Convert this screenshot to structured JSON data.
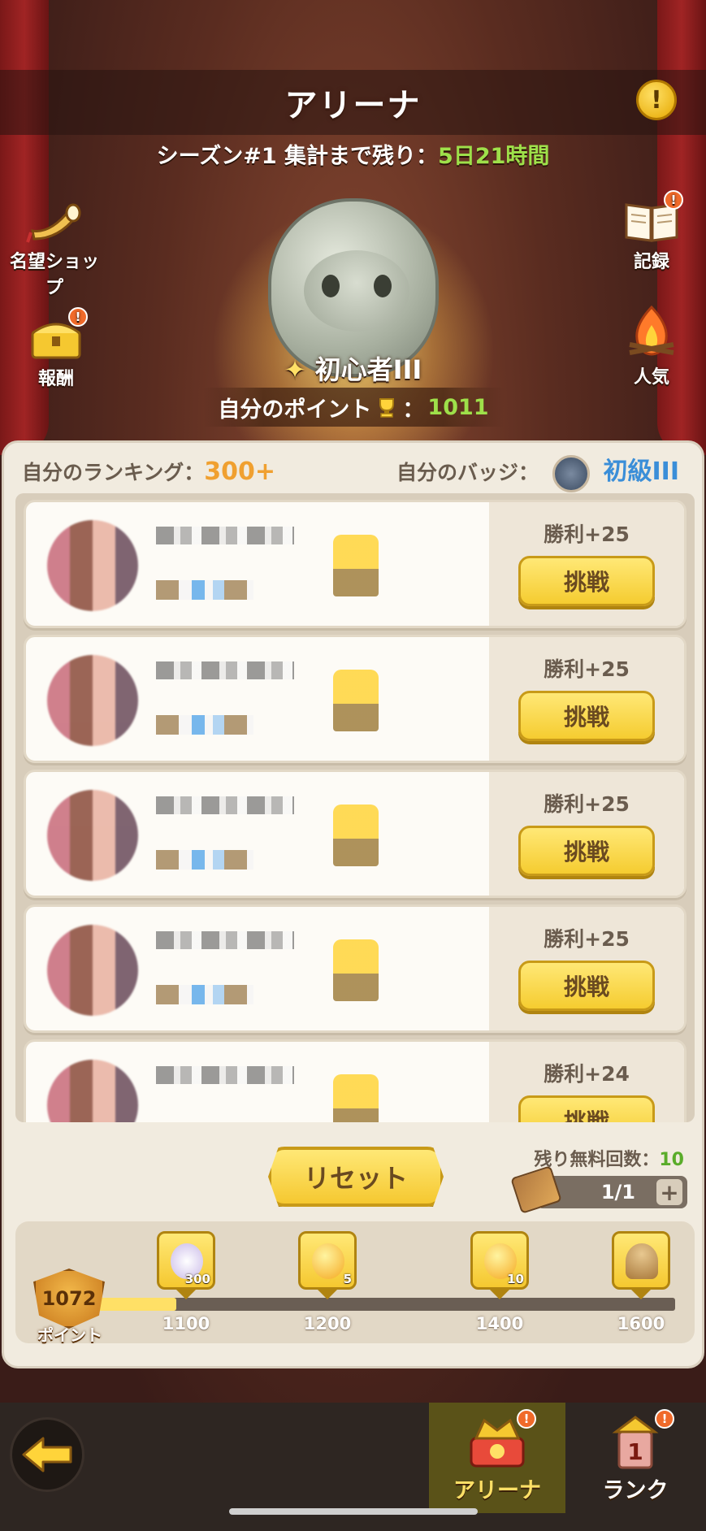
{
  "header": {
    "title": "アリーナ",
    "info_icon": "exclamation-icon",
    "season_text": "シーズン#1 集計まで残り：",
    "season_remaining": "5日21時間"
  },
  "side_menu": {
    "left": [
      {
        "label": "名望ショップ",
        "icon": "horn-icon",
        "alert": false
      },
      {
        "label": "報酬",
        "icon": "treasure-chest-icon",
        "alert": true
      }
    ],
    "right": [
      {
        "label": "記録",
        "icon": "book-icon",
        "alert": true
      },
      {
        "label": "人気",
        "icon": "campfire-icon",
        "alert": false
      }
    ],
    "alert_glyph": "!"
  },
  "rank": {
    "name": "初心者III",
    "points_label": "自分のポイント",
    "points_sep": "：",
    "points": "1011"
  },
  "panel": {
    "ranking_label": "自分のランキング：",
    "ranking_value": "300+",
    "badge_label": "自分のバッジ：",
    "badge_value": "初級III"
  },
  "opponents": [
    {
      "win_label": "勝利+25",
      "button": "挑戦"
    },
    {
      "win_label": "勝利+25",
      "button": "挑戦"
    },
    {
      "win_label": "勝利+25",
      "button": "挑戦"
    },
    {
      "win_label": "勝利+25",
      "button": "挑戦"
    },
    {
      "win_label": "勝利+24",
      "button": "挑戦"
    }
  ],
  "reset": {
    "button": "リセット",
    "free_label": "残り無料回数：",
    "free_value": "10",
    "ticket_value": "1/1",
    "plus": "+"
  },
  "rewards": {
    "current_points": "1072",
    "points_label": "ポイント",
    "progress_fraction": 0.15,
    "milestones": [
      {
        "value": "1100",
        "icon": "shell-icon",
        "qty": "300"
      },
      {
        "value": "1200",
        "icon": "egg-icon",
        "qty": "5"
      },
      {
        "value": "1400",
        "icon": "egg-icon",
        "qty": "10"
      },
      {
        "value": "1600",
        "icon": "mushroom-icon",
        "qty": ""
      }
    ]
  },
  "bottom_nav": {
    "back_icon": "back-arrow-icon",
    "tabs": [
      {
        "label": "アリーナ",
        "active": true,
        "alert": true
      },
      {
        "label": "ランク",
        "active": false,
        "alert": true
      }
    ]
  },
  "colors": {
    "accent_green": "#9ee04a",
    "accent_orange": "#f0a030",
    "accent_blue": "#3a8ed8",
    "button_yellow": "#f5cc30"
  }
}
